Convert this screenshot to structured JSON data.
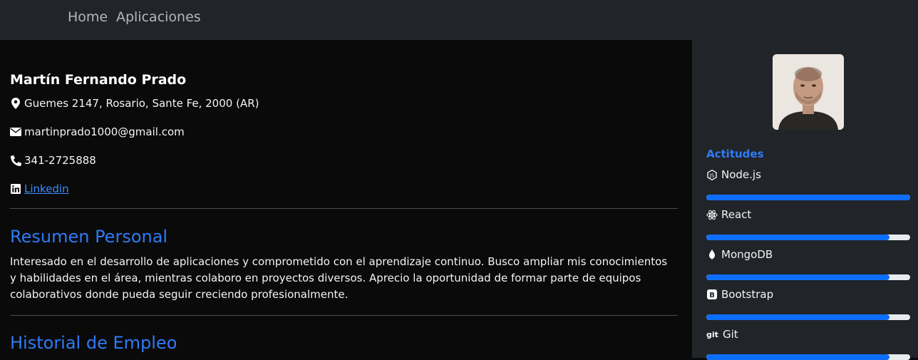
{
  "nav": {
    "home": "Home",
    "apps": "Aplicaciones"
  },
  "profile": {
    "name": "Martín Fernando Prado",
    "address": "Guemes 2147, Rosario, Sante Fe, 2000 (AR)",
    "email": "martinprado1000@gmail.com",
    "phone": "341-2725888",
    "linkedin_label": "Linkedin"
  },
  "sections": {
    "resumen_title": "Resumen Personal",
    "resumen_text": "Interesado en el desarrollo de aplicaciones y comprometido con el aprendizaje continuo. Busco ampliar mis conocimientos y habilidades en el área, mientras colaboro en proyectos diversos. Aprecio la oportunidad de formar parte de equipos colaborativos donde pueda seguir creciendo profesionalmente.",
    "historial_title": "Historial de Empleo"
  },
  "sidebar": {
    "skills_title": "Actitudes",
    "skills": [
      {
        "label": "Node.js",
        "icon": "nodejs-icon",
        "level": 1.0
      },
      {
        "label": "React",
        "icon": "react-icon",
        "level": 0.9
      },
      {
        "label": "MongoDB",
        "icon": "mongodb-icon",
        "level": 0.9
      },
      {
        "label": "Bootstrap",
        "icon": "bootstrap-icon",
        "level": 0.9
      },
      {
        "label": "Git",
        "icon": "git-icon",
        "level": 0.9
      }
    ]
  },
  "colors": {
    "accent": "#0d6efd",
    "heading_blue": "#2f7bf6",
    "nav_bg": "#212429",
    "main_bg": "#0a0a0b"
  }
}
